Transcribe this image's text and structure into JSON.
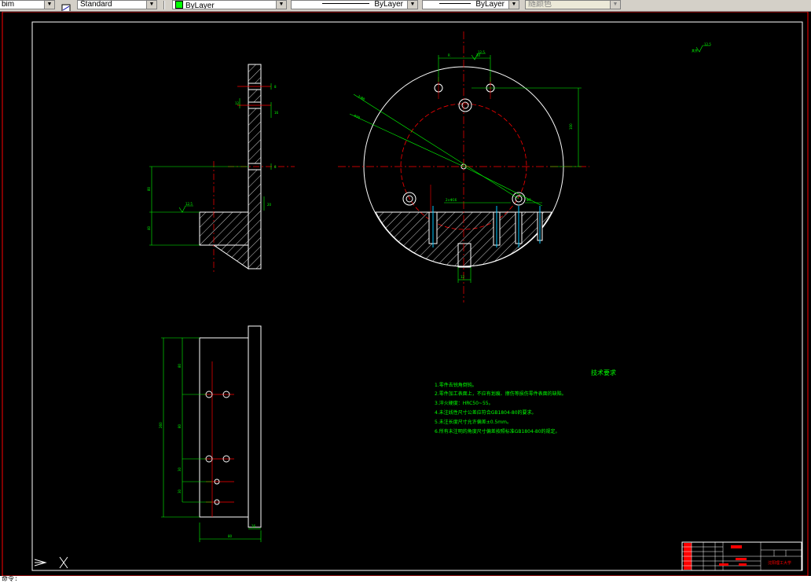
{
  "toolbar": {
    "dim_style": "bim",
    "text_style": "Standard",
    "layer_color": "ByLayer",
    "linetype": "ByLayer",
    "lineweight": "ByLayer",
    "plot_style": "随颜色"
  },
  "drawing": {
    "surface_mark": "12.5",
    "notes_title": "技术要求",
    "notes": [
      "1.零件去锐角倒钝。",
      "2.零件加工表面上，不应有划痕、擦伤等损伤零件表面的缺陷。",
      "3.淬火硬度：HRC50~55。",
      "4.未注线性尺寸公差应符合GB1804-80的要求。",
      "5.未注长度尺寸允许偏差±0.5mm。",
      "6.所有未注明的角度尺寸偏差按照标准GB1804-80的规定。"
    ],
    "title_block_name": "沈阳理工大学"
  },
  "colors": {
    "background": "#000000",
    "frame": "#ffffff",
    "outer_frame": "#ff0000",
    "center_line": "#ff0000",
    "dimension": "#00ff00",
    "hatch": "#ffffff",
    "notes": "#00ff00",
    "cyan": "#00c8ff"
  },
  "command_line": "命令:"
}
